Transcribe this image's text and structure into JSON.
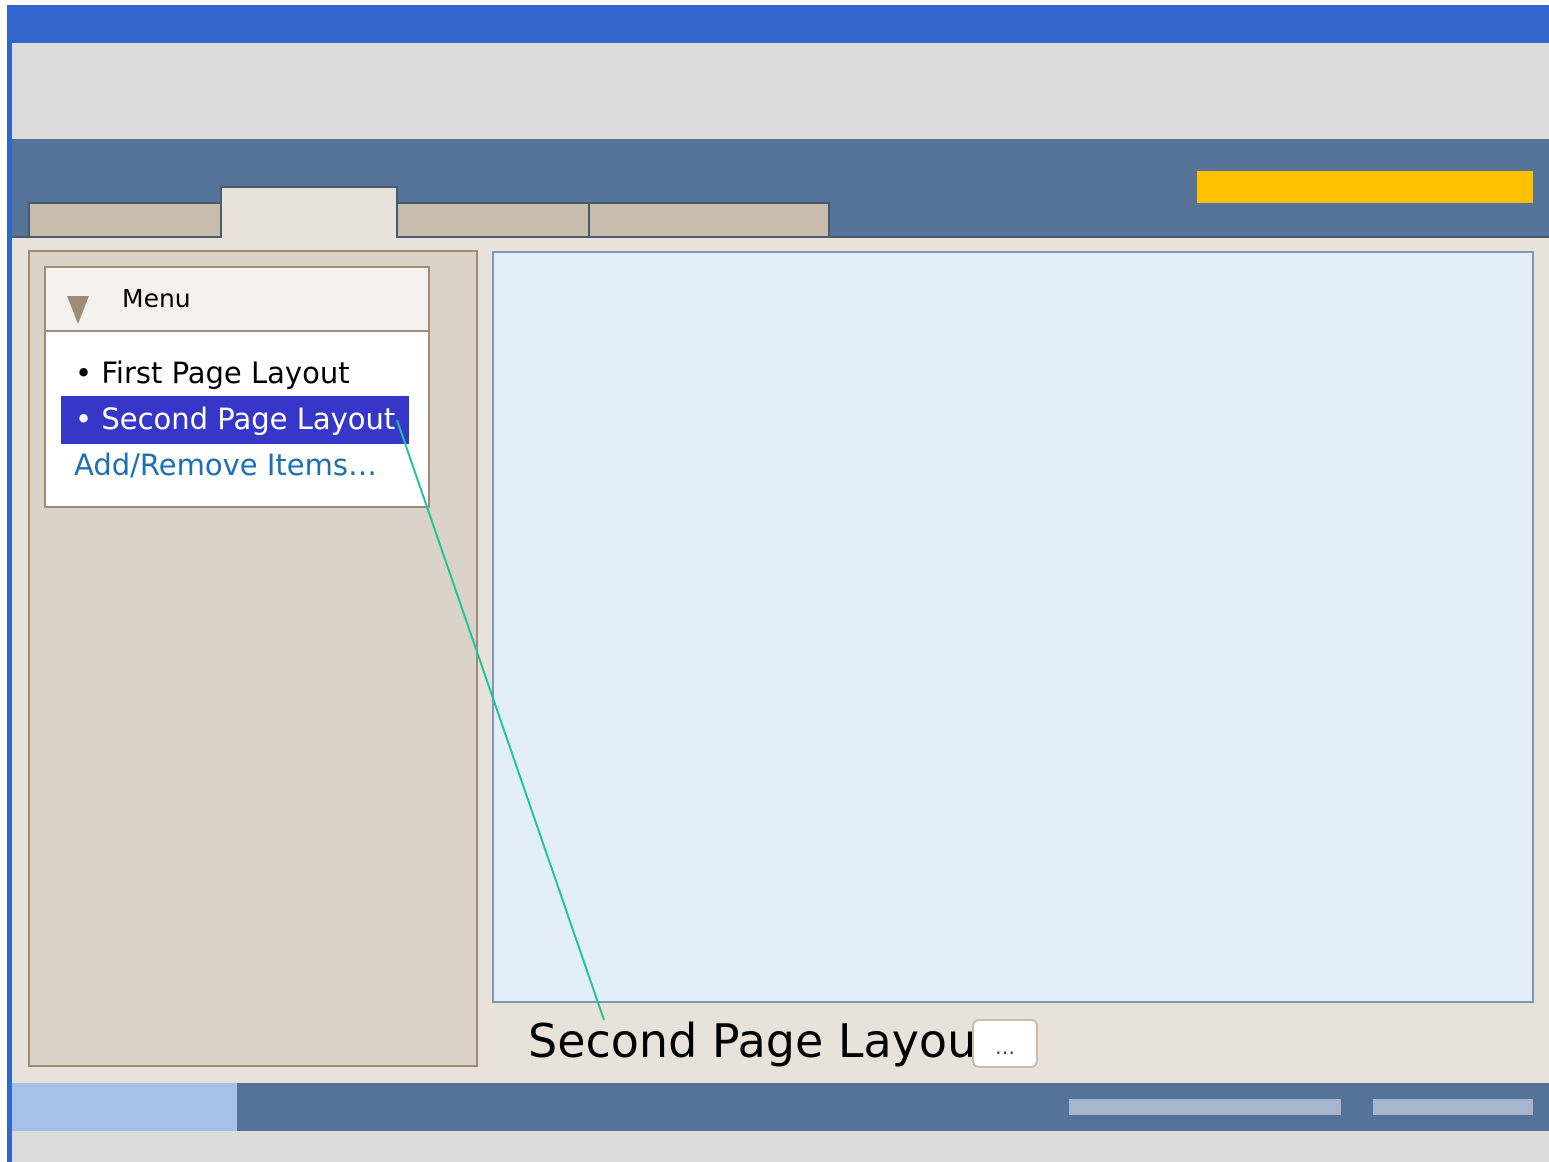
{
  "colors": {
    "title_bar": "#3366cc",
    "tab_bar": "#557399",
    "accent": "#ffc000",
    "selected_item": "#3636c8",
    "link": "#1f6fb5",
    "callout_line": "#1bc49a",
    "main_panel": "#e4eefa"
  },
  "menu": {
    "title": "Menu",
    "expand_icon": "triangle-down-icon",
    "items": [
      {
        "label": "• First Page Layout",
        "selected": false
      },
      {
        "label": "• Second Page Layout",
        "selected": true
      }
    ],
    "link_label": "Add/Remove Items…"
  },
  "main": {
    "page_label": "Second Page Layout",
    "more_button_label": "…"
  }
}
